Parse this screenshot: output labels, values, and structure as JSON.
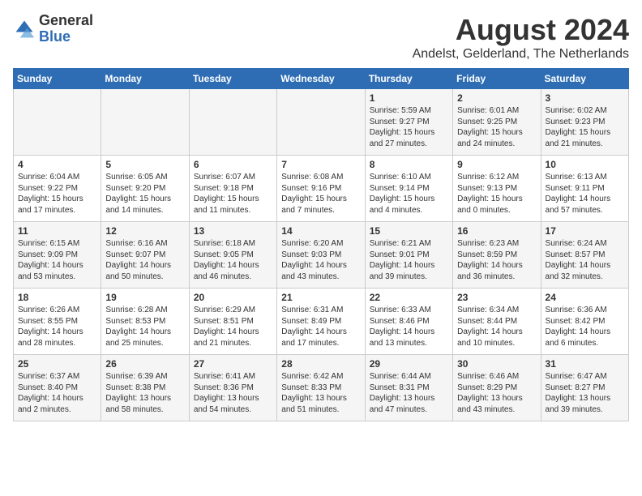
{
  "header": {
    "logo": {
      "text_general": "General",
      "text_blue": "Blue"
    },
    "title": "August 2024",
    "subtitle": "Andelst, Gelderland, The Netherlands"
  },
  "calendar": {
    "days_of_week": [
      "Sunday",
      "Monday",
      "Tuesday",
      "Wednesday",
      "Thursday",
      "Friday",
      "Saturday"
    ],
    "weeks": [
      [
        {
          "day": "",
          "info": ""
        },
        {
          "day": "",
          "info": ""
        },
        {
          "day": "",
          "info": ""
        },
        {
          "day": "",
          "info": ""
        },
        {
          "day": "1",
          "info": "Sunrise: 5:59 AM\nSunset: 9:27 PM\nDaylight: 15 hours\nand 27 minutes."
        },
        {
          "day": "2",
          "info": "Sunrise: 6:01 AM\nSunset: 9:25 PM\nDaylight: 15 hours\nand 24 minutes."
        },
        {
          "day": "3",
          "info": "Sunrise: 6:02 AM\nSunset: 9:23 PM\nDaylight: 15 hours\nand 21 minutes."
        }
      ],
      [
        {
          "day": "4",
          "info": "Sunrise: 6:04 AM\nSunset: 9:22 PM\nDaylight: 15 hours\nand 17 minutes."
        },
        {
          "day": "5",
          "info": "Sunrise: 6:05 AM\nSunset: 9:20 PM\nDaylight: 15 hours\nand 14 minutes."
        },
        {
          "day": "6",
          "info": "Sunrise: 6:07 AM\nSunset: 9:18 PM\nDaylight: 15 hours\nand 11 minutes."
        },
        {
          "day": "7",
          "info": "Sunrise: 6:08 AM\nSunset: 9:16 PM\nDaylight: 15 hours\nand 7 minutes."
        },
        {
          "day": "8",
          "info": "Sunrise: 6:10 AM\nSunset: 9:14 PM\nDaylight: 15 hours\nand 4 minutes."
        },
        {
          "day": "9",
          "info": "Sunrise: 6:12 AM\nSunset: 9:13 PM\nDaylight: 15 hours\nand 0 minutes."
        },
        {
          "day": "10",
          "info": "Sunrise: 6:13 AM\nSunset: 9:11 PM\nDaylight: 14 hours\nand 57 minutes."
        }
      ],
      [
        {
          "day": "11",
          "info": "Sunrise: 6:15 AM\nSunset: 9:09 PM\nDaylight: 14 hours\nand 53 minutes."
        },
        {
          "day": "12",
          "info": "Sunrise: 6:16 AM\nSunset: 9:07 PM\nDaylight: 14 hours\nand 50 minutes."
        },
        {
          "day": "13",
          "info": "Sunrise: 6:18 AM\nSunset: 9:05 PM\nDaylight: 14 hours\nand 46 minutes."
        },
        {
          "day": "14",
          "info": "Sunrise: 6:20 AM\nSunset: 9:03 PM\nDaylight: 14 hours\nand 43 minutes."
        },
        {
          "day": "15",
          "info": "Sunrise: 6:21 AM\nSunset: 9:01 PM\nDaylight: 14 hours\nand 39 minutes."
        },
        {
          "day": "16",
          "info": "Sunrise: 6:23 AM\nSunset: 8:59 PM\nDaylight: 14 hours\nand 36 minutes."
        },
        {
          "day": "17",
          "info": "Sunrise: 6:24 AM\nSunset: 8:57 PM\nDaylight: 14 hours\nand 32 minutes."
        }
      ],
      [
        {
          "day": "18",
          "info": "Sunrise: 6:26 AM\nSunset: 8:55 PM\nDaylight: 14 hours\nand 28 minutes."
        },
        {
          "day": "19",
          "info": "Sunrise: 6:28 AM\nSunset: 8:53 PM\nDaylight: 14 hours\nand 25 minutes."
        },
        {
          "day": "20",
          "info": "Sunrise: 6:29 AM\nSunset: 8:51 PM\nDaylight: 14 hours\nand 21 minutes."
        },
        {
          "day": "21",
          "info": "Sunrise: 6:31 AM\nSunset: 8:49 PM\nDaylight: 14 hours\nand 17 minutes."
        },
        {
          "day": "22",
          "info": "Sunrise: 6:33 AM\nSunset: 8:46 PM\nDaylight: 14 hours\nand 13 minutes."
        },
        {
          "day": "23",
          "info": "Sunrise: 6:34 AM\nSunset: 8:44 PM\nDaylight: 14 hours\nand 10 minutes."
        },
        {
          "day": "24",
          "info": "Sunrise: 6:36 AM\nSunset: 8:42 PM\nDaylight: 14 hours\nand 6 minutes."
        }
      ],
      [
        {
          "day": "25",
          "info": "Sunrise: 6:37 AM\nSunset: 8:40 PM\nDaylight: 14 hours\nand 2 minutes."
        },
        {
          "day": "26",
          "info": "Sunrise: 6:39 AM\nSunset: 8:38 PM\nDaylight: 13 hours\nand 58 minutes."
        },
        {
          "day": "27",
          "info": "Sunrise: 6:41 AM\nSunset: 8:36 PM\nDaylight: 13 hours\nand 54 minutes."
        },
        {
          "day": "28",
          "info": "Sunrise: 6:42 AM\nSunset: 8:33 PM\nDaylight: 13 hours\nand 51 minutes."
        },
        {
          "day": "29",
          "info": "Sunrise: 6:44 AM\nSunset: 8:31 PM\nDaylight: 13 hours\nand 47 minutes."
        },
        {
          "day": "30",
          "info": "Sunrise: 6:46 AM\nSunset: 8:29 PM\nDaylight: 13 hours\nand 43 minutes."
        },
        {
          "day": "31",
          "info": "Sunrise: 6:47 AM\nSunset: 8:27 PM\nDaylight: 13 hours\nand 39 minutes."
        }
      ]
    ]
  }
}
